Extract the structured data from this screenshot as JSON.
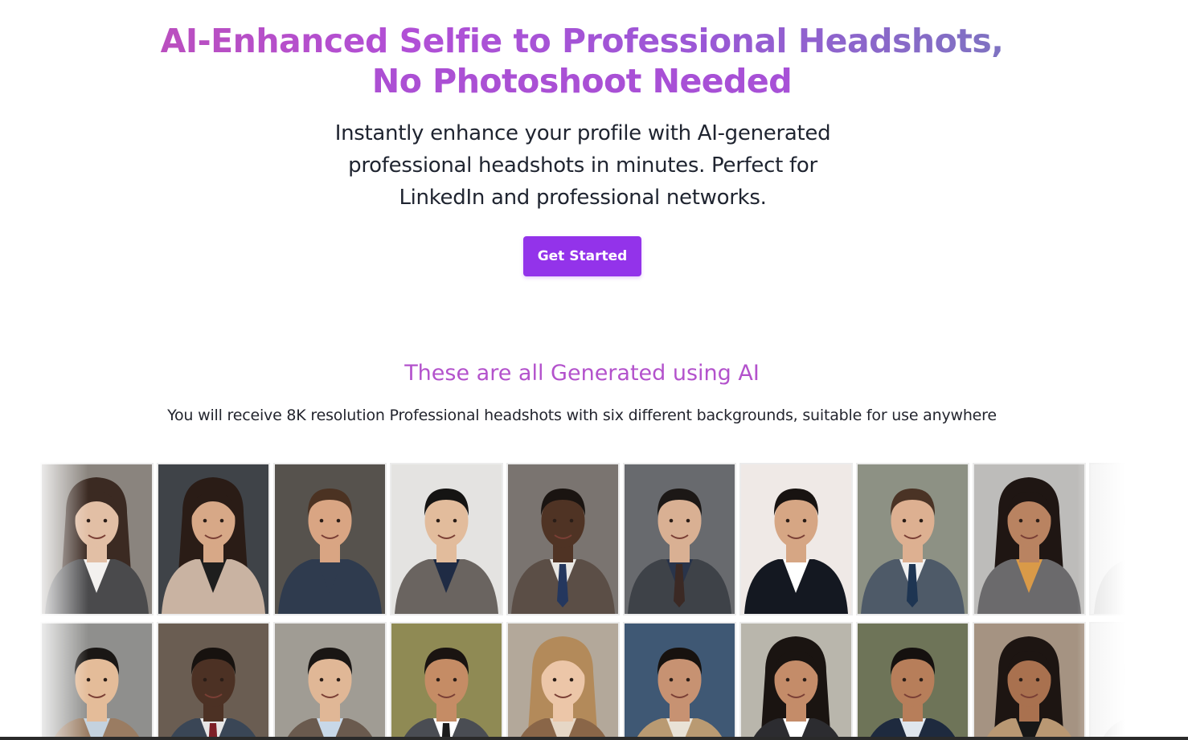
{
  "hero": {
    "title_line1": "AI-Enhanced Selfie to Professional Headshots,",
    "title_line2": "No Photoshoot Needed",
    "subtitle": "Instantly enhance your profile with AI-generated professional headshots in minutes. Perfect for LinkedIn and professional networks.",
    "cta_label": "Get Started"
  },
  "gallery": {
    "heading": "These are all Generated using AI",
    "caption": "You will receive 8K resolution Professional headshots with six different backgrounds, suitable for use anywhere",
    "rows": [
      {
        "tiles": [
          {
            "bg": "#8a847e",
            "skin": "#e2bfa5",
            "hair": "#3b2a22",
            "outfit": "#4a4a4c",
            "shirt": "#f3f1ef",
            "tie": null,
            "long_hair": true
          },
          {
            "bg": "#3f4348",
            "skin": "#d7a887",
            "hair": "#2a1c16",
            "outfit": "#c9b3a2",
            "shirt": "#1e1e1e",
            "tie": null,
            "long_hair": true
          },
          {
            "bg": "#56524d",
            "skin": "#d9a583",
            "hair": "#4b3222",
            "outfit": "#2f3b4e",
            "shirt": "#2f3b4e",
            "tie": null,
            "long_hair": false
          },
          {
            "bg": "#e4e3e1",
            "skin": "#e2bc9c",
            "hair": "#151413",
            "outfit": "#6a6460",
            "shirt": "#1f2b44",
            "tie": null,
            "long_hair": false
          },
          {
            "bg": "#7a7470",
            "skin": "#4f3324",
            "hair": "#1a1411",
            "outfit": "#5b4e46",
            "shirt": "#e9e7e3",
            "tie": "#24375e",
            "long_hair": false
          },
          {
            "bg": "#686a6e",
            "skin": "#d9b093",
            "hair": "#1c1816",
            "outfit": "#3e4248",
            "shirt": "#29344a",
            "tie": "#3b2924",
            "long_hair": false
          },
          {
            "bg": "#efe9e6",
            "skin": "#d6a684",
            "hair": "#181311",
            "outfit": "#141821",
            "shirt": "#ffffff",
            "tie": null,
            "long_hair": false
          },
          {
            "bg": "#8d9184",
            "skin": "#ddb091",
            "hair": "#4a3325",
            "outfit": "#4e5a68",
            "shirt": "#f1f1f1",
            "tie": "#1e3552",
            "long_hair": false
          },
          {
            "bg": "#bdbcba",
            "skin": "#b98361",
            "hair": "#1f1613",
            "outfit": "#6b6a6c",
            "shirt": "#d99a48",
            "tie": null,
            "long_hair": true
          },
          {
            "bg": "#f1f1f1",
            "skin": "#e5cdbd",
            "hair": "#cfcfcf",
            "outfit": "#dddddd",
            "shirt": "#eeeeee",
            "tie": null,
            "long_hair": false
          }
        ]
      },
      {
        "tiles": [
          {
            "bg": "#8f8f8d",
            "skin": "#e4bc99",
            "hair": "#1a1715",
            "outfit": "#9a7c62",
            "shirt": "#c4d2de",
            "tie": null,
            "long_hair": false
          },
          {
            "bg": "#6a5d52",
            "skin": "#4c3124",
            "hair": "#17120f",
            "outfit": "#3a4656",
            "shirt": "#e6e6e6",
            "tie": "#7d1f27",
            "long_hair": false
          },
          {
            "bg": "#a09c94",
            "skin": "#e0b796",
            "hair": "#1a1614",
            "outfit": "#6a5a4e",
            "shirt": "#c8d8e8",
            "tie": null,
            "long_hair": false
          },
          {
            "bg": "#8f8a54",
            "skin": "#c58c65",
            "hair": "#1a1411",
            "outfit": "#4a4d53",
            "shirt": "#ffffff",
            "tie": "#1c1c1c",
            "long_hair": false
          },
          {
            "bg": "#b3a89a",
            "skin": "#ecc6a8",
            "hair": "#b38a5a",
            "outfit": "#8a6648",
            "shirt": "#e6d7c6",
            "tie": null,
            "long_hair": true
          },
          {
            "bg": "#3f5874",
            "skin": "#c79272",
            "hair": "#17120f",
            "outfit": "#b99a72",
            "shirt": "#e9e2d6",
            "tie": null,
            "long_hair": false
          },
          {
            "bg": "#b9b6ac",
            "skin": "#c48c69",
            "hair": "#1a1411",
            "outfit": "#2c2c30",
            "shirt": "#ffffff",
            "tie": null,
            "long_hair": true
          },
          {
            "bg": "#6e7458",
            "skin": "#b77e5a",
            "hair": "#15110f",
            "outfit": "#1e2a3e",
            "shirt": "#dfe6ee",
            "tie": null,
            "long_hair": false
          },
          {
            "bg": "#a59382",
            "skin": "#a9714f",
            "hair": "#1d1512",
            "outfit": "#b99873",
            "shirt": "#171717",
            "tie": null,
            "long_hair": true
          },
          {
            "bg": "#f1f1f1",
            "skin": "#d8c4b8",
            "hair": "#bdbdbd",
            "outfit": "#dddddd",
            "shirt": "#eeeeee",
            "tie": null,
            "long_hair": false
          }
        ]
      }
    ]
  }
}
